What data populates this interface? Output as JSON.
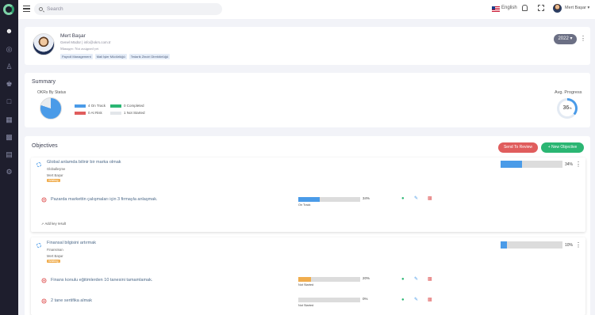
{
  "topbar": {
    "search_placeholder": "Search",
    "language": "English",
    "user_name": "Mert Başar"
  },
  "profile": {
    "name": "Mert Başar",
    "role_email": "Genel Müdür | info@okrs.com.tr",
    "manager": "Manager: Not assigned yet",
    "tags": [
      "Payroll Management",
      "Mali İşler Müdürlüğü",
      "Tedarik Zinciri Direktörlüğü"
    ],
    "year": "2022"
  },
  "summary": {
    "title": "Summary",
    "okrs_label": "OKRs By Status",
    "legend": [
      {
        "label": "4 On Track",
        "color": "#4a9be8"
      },
      {
        "label": "0 Completed",
        "color": "#2bb673"
      },
      {
        "label": "0 At Risk",
        "color": "#e05d5d"
      },
      {
        "label": "1 Not Started",
        "color": "#e3e6ea"
      }
    ],
    "avg_label": "Avg. Progress",
    "avg_value": "36",
    "avg_unit": "%"
  },
  "objectives": {
    "title": "Objectives",
    "send_review": "Send To Review",
    "new_objective": "+ New Objective",
    "add_key_result": "Add key result",
    "items": [
      {
        "title": "Global anlamda bilinir bir marka olmak",
        "category": "Globalleşme",
        "owner": "Mert Başar",
        "badge": "Waiting",
        "progress": 34,
        "progress_text": "34%",
        "key_results": [
          {
            "title": "Pazarda markettin çalışmaları için 3 firmayla anlaşmak.",
            "progress": 34,
            "progress_text": "34%",
            "status": "On Track",
            "color": "#4a9be8"
          }
        ]
      },
      {
        "title": "Finansal bilgisini artırmak",
        "category": "Finansman",
        "owner": "Mert Başar",
        "badge": "Waiting",
        "progress": 10,
        "progress_text": "10%",
        "key_results": [
          {
            "title": "Finans konulu eğitimlerden 10 tanesini tamamlamak.",
            "progress": 20,
            "progress_text": "20%",
            "status": "Not Started",
            "color": "#f0ad4e"
          },
          {
            "title": "2 tane sertifika almak",
            "progress": 0,
            "progress_text": "0%",
            "status": "Not Started",
            "color": "#4a9be8"
          }
        ]
      }
    ]
  }
}
